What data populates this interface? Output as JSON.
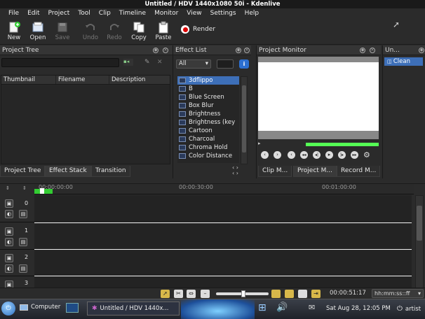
{
  "window": {
    "title": "Untitled / HDV 1440x1080 50i - Kdenlive"
  },
  "menu": [
    "File",
    "Edit",
    "Project",
    "Tool",
    "Clip",
    "Timeline",
    "Monitor",
    "View",
    "Settings",
    "Help"
  ],
  "toolbar": {
    "new": "New",
    "open": "Open",
    "save": "Save",
    "undo": "Undo",
    "redo": "Redo",
    "copy": "Copy",
    "paste": "Paste",
    "render": "Render"
  },
  "project_tree": {
    "title": "Project Tree",
    "columns": [
      "Thumbnail",
      "Filename",
      "Description"
    ],
    "tabs": [
      "Project Tree",
      "Effect Stack",
      "Transition"
    ]
  },
  "effect_list": {
    "title": "Effect List",
    "filter": "All",
    "items": [
      "3dflippo",
      "B",
      "Blue Screen",
      "Box Blur",
      "Brightness",
      "Brightness (key",
      "Cartoon",
      "Charcoal",
      "Chroma Hold",
      "Color Distance"
    ]
  },
  "project_monitor": {
    "title": "Project Monitor",
    "tabs": [
      "Clip M...",
      "Project M...",
      "Record M..."
    ]
  },
  "undo_panel": {
    "title": "Un...",
    "item": "Clean"
  },
  "timeline": {
    "ruler": [
      "00:00:00:00",
      "00:00:30:00",
      "00:01:00:00"
    ],
    "tracks": [
      "0",
      "1",
      "2",
      "3"
    ]
  },
  "statusbar": {
    "timecode": "00:00:51:17",
    "format": "hh:mm:ss::ff"
  },
  "taskbar": {
    "computer": "Computer",
    "window_button": "Untitled / HDV 1440x...",
    "datetime": "Sat Aug 28, 12:05 PM",
    "user": "artist"
  }
}
